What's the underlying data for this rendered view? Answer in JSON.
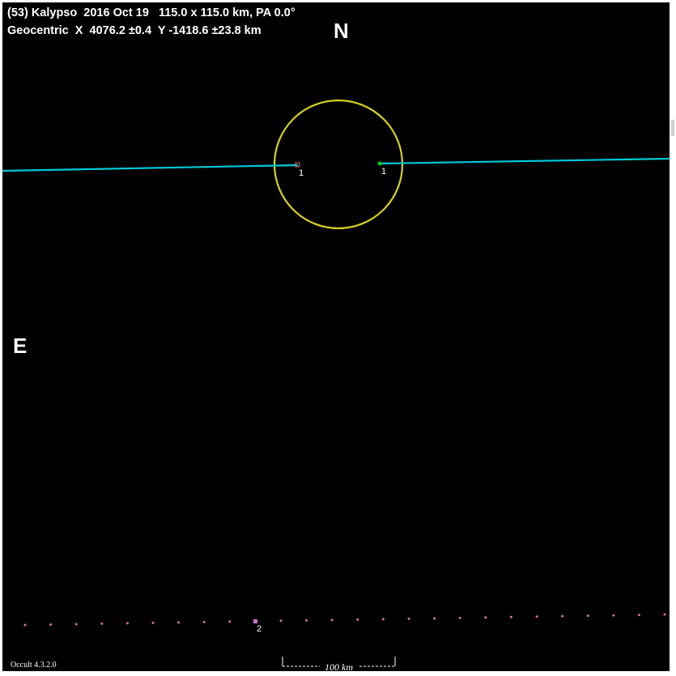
{
  "header": {
    "title": "(53) Kalypso  2016 Oct 19   115.0 x 115.0 km, PA 0.0°",
    "geocentric": "Geocentric  X  4076.2 ±0.4  Y -1418.6 ±23.8 km"
  },
  "orientation": {
    "north": "N",
    "east": "E"
  },
  "footer": {
    "version": "Occult 4.3.2.0",
    "scale_label": "100 km"
  },
  "chords": [
    {
      "label": "1",
      "color": "#00c8d8",
      "side": "disappearance",
      "marker_color": "#e07070"
    },
    {
      "label": "1",
      "color": "#00c8d8",
      "side": "reappearance",
      "marker_color": "#00d000"
    }
  ],
  "miss_chord": {
    "label": "2",
    "color": "#e07090"
  },
  "colors": {
    "background": "#000000",
    "asteroid_profile": "#d8d020",
    "chord": "#00c8d8",
    "text": "#ffffff"
  },
  "asteroid_profile": {
    "diameter_km": 115.0,
    "shape": "circle",
    "position_angle_deg": 0.0
  }
}
